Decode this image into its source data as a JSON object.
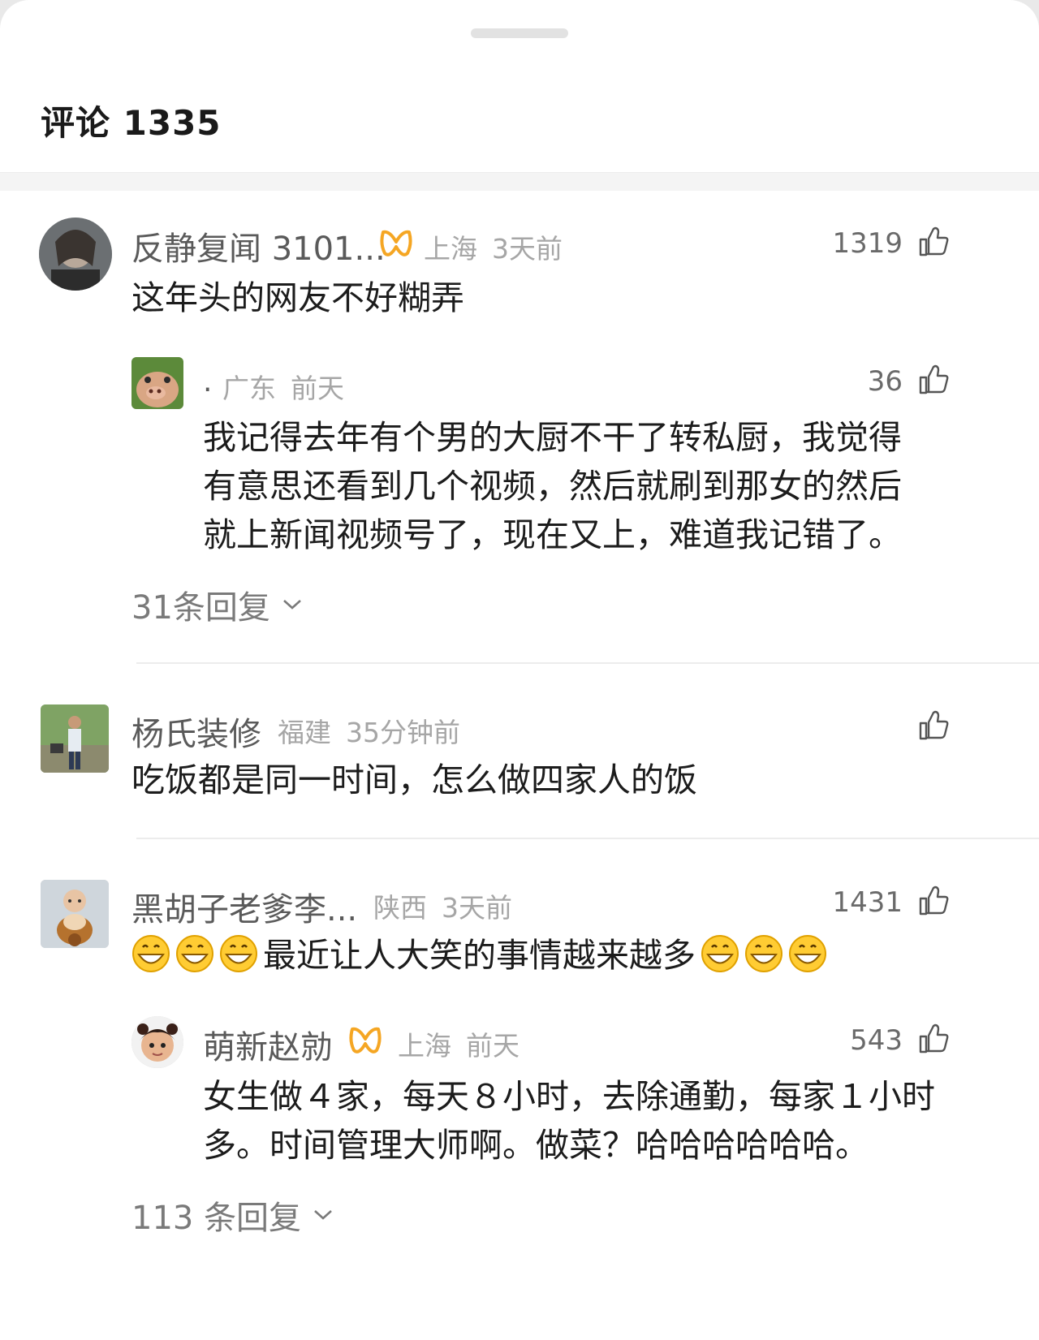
{
  "sheet": {
    "title": "评论 1335"
  },
  "comments": [
    {
      "name": "反静复闻 3101...",
      "location": "上海",
      "time": "3天前",
      "likes": "1319",
      "text": "这年头的网友不好糊弄",
      "vip": true,
      "reply": {
        "name": ".",
        "location": "广东",
        "time": "前天",
        "likes": "36",
        "lines": [
          "我记得去年有个男的大厨不干了转私厨，我觉得",
          "有意思还看到几个视频，然后就刷到那女的然后",
          "就上新闻视频号了，现在又上，难道我记错了。"
        ]
      },
      "replies_label": "31条回复"
    },
    {
      "name": "杨氏装修",
      "location": "福建",
      "time": "35分钟前",
      "likes": "",
      "text": "吃饭都是同一时间，怎么做四家人的饭"
    },
    {
      "name": "黑胡子老爹李...",
      "location": "陕西",
      "time": "3天前",
      "likes": "1431",
      "text": "最近让人大笑的事情越来越多",
      "reply": {
        "name": "萌新赵勍",
        "location": "上海",
        "time": "前天",
        "likes": "543",
        "vip": true,
        "lines": [
          "女生做４家，每天８小时，去除通勤，每家１小时",
          "多。时间管理大师啊。做菜？哈哈哈哈哈哈。"
        ]
      },
      "replies_label": "113 条回复"
    }
  ],
  "icons": {
    "like": "thumbs-up-icon",
    "vip": "vip-badge-icon",
    "expand": "chevron-down-icon",
    "emoji": "grinning-emoji-icon"
  },
  "colors": {
    "vip_badge": "#f5a623",
    "meta": "#a6a6a6"
  }
}
